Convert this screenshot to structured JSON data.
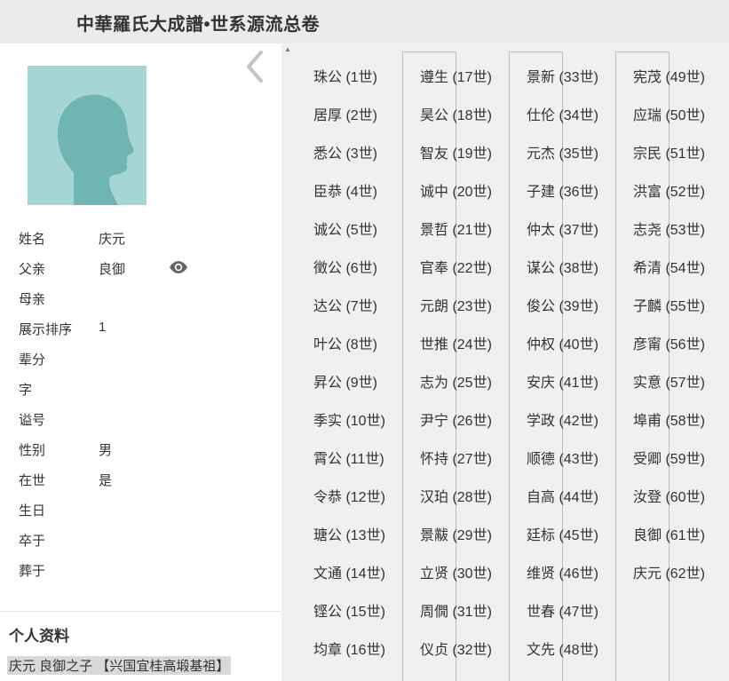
{
  "header": {
    "title": "中華羅氏大成譜•世系源流总卷"
  },
  "profile": {
    "fields": [
      {
        "label": "姓名",
        "value": "庆元"
      },
      {
        "label": "父亲",
        "value": "良御"
      },
      {
        "label": "母亲",
        "value": ""
      },
      {
        "label": "展示排序",
        "value": "1"
      },
      {
        "label": "辈分",
        "value": ""
      },
      {
        "label": "字",
        "value": ""
      },
      {
        "label": "谥号",
        "value": ""
      },
      {
        "label": "性别",
        "value": "男"
      },
      {
        "label": "在世",
        "value": "是"
      },
      {
        "label": "生日",
        "value": ""
      },
      {
        "label": "卒于",
        "value": ""
      },
      {
        "label": "葬于",
        "value": ""
      }
    ],
    "section_title": "个人资料",
    "bio": "庆元  良御之子  【兴国宜桂高塅基祖】"
  },
  "icons": {
    "collapse": "chevron-left-icon",
    "eye": "eye-icon",
    "avatar": "person-silhouette-icon"
  },
  "colors": {
    "avatar_bg": "#a5d6d3",
    "avatar_fg": "#6fb5b1",
    "right_bg": "#f0f0f0"
  },
  "generations": [
    [
      "珠公 (1世)",
      "居厚 (2世)",
      "悉公 (3世)",
      "臣恭 (4世)",
      "诚公 (5世)",
      "徵公 (6世)",
      "达公 (7世)",
      "叶公 (8世)",
      "昇公 (9世)",
      "季实 (10世)",
      "霄公 (11世)",
      "令恭 (12世)",
      "瑭公 (13世)",
      "文通 (14世)",
      "铿公 (15世)",
      "均章 (16世)"
    ],
    [
      "遵生 (17世)",
      "昊公 (18世)",
      "智友 (19世)",
      "诚中 (20世)",
      "景哲 (21世)",
      "官奉 (22世)",
      "元朗 (23世)",
      "世推 (24世)",
      "志为 (25世)",
      "尹宁 (26世)",
      "怀持 (27世)",
      "汉珀 (28世)",
      "景黻 (29世)",
      "立贤 (30世)",
      "周僩 (31世)",
      "仪贞 (32世)"
    ],
    [
      "景新 (33世)",
      "仕伦 (34世)",
      "元杰 (35世)",
      "子建 (36世)",
      "仲太 (37世)",
      "谋公 (38世)",
      "俊公 (39世)",
      "仲权 (40世)",
      "安庆 (41世)",
      "学政 (42世)",
      "顺德 (43世)",
      "自高 (44世)",
      "廷标 (45世)",
      "维贤 (46世)",
      "世春 (47世)",
      "文先 (48世)"
    ],
    [
      "宪茂 (49世)",
      "应瑞 (50世)",
      "宗民 (51世)",
      "洪富 (52世)",
      "志尧 (53世)",
      "希清 (54世)",
      "子麟 (55世)",
      "彦甯 (56世)",
      "实意 (57世)",
      "埠甫 (58世)",
      "受卿 (59世)",
      "汝登 (60世)",
      "良御 (61世)",
      "庆元 (62世)"
    ]
  ]
}
